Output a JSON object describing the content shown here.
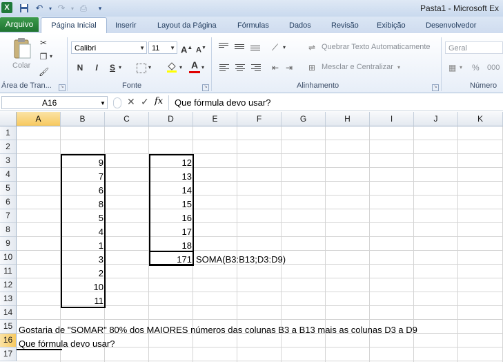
{
  "window": {
    "title": "Pasta1 - Microsoft Ex"
  },
  "tabs": {
    "file": "Arquivo",
    "home": "Página Inicial",
    "items": [
      "Inserir",
      "Layout da Página",
      "Fórmulas",
      "Dados",
      "Revisão",
      "Exibição",
      "Desenvolvedor"
    ]
  },
  "ribbon": {
    "clipboard": {
      "paste_label": "Colar",
      "group_label": "Área de Tran..."
    },
    "font": {
      "group_label": "Fonte",
      "font_name": "Calibri",
      "font_size": "11",
      "bold": "N",
      "italic": "I",
      "underline": "S"
    },
    "alignment": {
      "group_label": "Alinhamento",
      "wrap_text": "Quebrar Texto Automaticamente",
      "merge_center": "Mesclar e Centralizar"
    },
    "number": {
      "group_label": "Número",
      "format": "Geral",
      "percent": "%",
      "thousands": "000"
    }
  },
  "formula_bar": {
    "name_box": "A16",
    "fx": "fx",
    "content": "Que fórmula devo usar?"
  },
  "grid": {
    "columns": [
      "A",
      "B",
      "C",
      "D",
      "E",
      "F",
      "G",
      "H",
      "I",
      "J",
      "K"
    ],
    "selected_column": "A",
    "rows": [
      "1",
      "2",
      "3",
      "4",
      "5",
      "6",
      "7",
      "8",
      "9",
      "10",
      "11",
      "12",
      "13",
      "14",
      "15",
      "16",
      "17"
    ],
    "selected_row": "16",
    "col_b_values": [
      "9",
      "7",
      "6",
      "8",
      "5",
      "4",
      "1",
      "3",
      "2",
      "10",
      "11"
    ],
    "col_d_values": [
      "12",
      "13",
      "14",
      "15",
      "16",
      "17",
      "18"
    ],
    "d10_value": "171",
    "e10_text": "SOMA(B3:B13;D3:D9)",
    "a15_text": "Gostaria de \"SOMAR\" 80% dos MAIORES números das colunas B3 a B13 mais as colunas D3 a D9",
    "a16_text": "Que fórmula devo usar?"
  }
}
